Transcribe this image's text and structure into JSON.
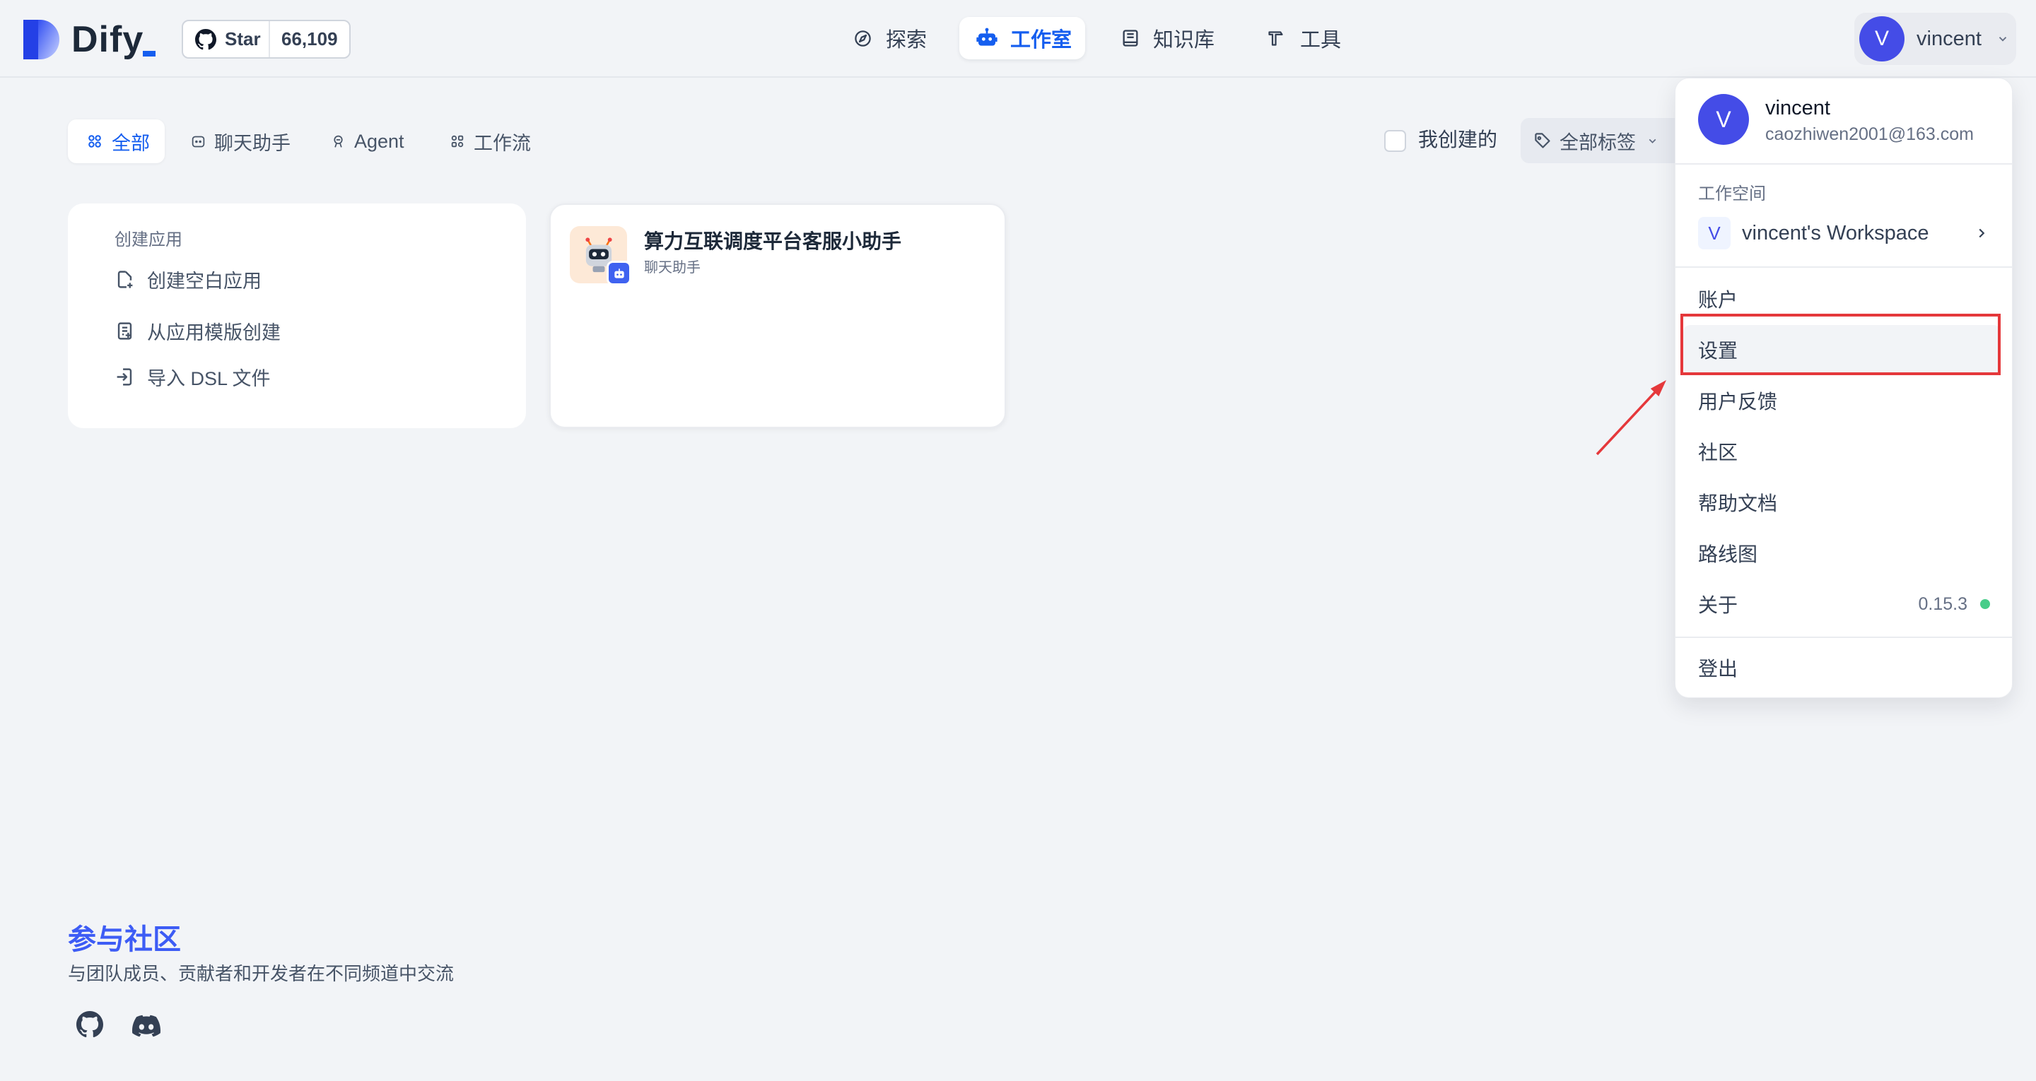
{
  "app": {
    "logo_text": "Dify"
  },
  "github": {
    "star_label": "Star",
    "star_count": "66,109",
    "icon": "github-icon"
  },
  "nav": {
    "items": [
      {
        "label": "探索",
        "icon": "explore-icon"
      },
      {
        "label": "工作室",
        "icon": "robot-icon",
        "active": true
      },
      {
        "label": "知识库",
        "icon": "book-icon"
      },
      {
        "label": "工具",
        "icon": "hammer-icon"
      }
    ]
  },
  "user": {
    "initial": "V",
    "name": "vincent"
  },
  "filters": {
    "tabs": [
      {
        "label": "全部",
        "icon": "grid-icon",
        "active": true
      },
      {
        "label": "聊天助手",
        "icon": "chat-icon"
      },
      {
        "label": "Agent",
        "icon": "agent-icon"
      },
      {
        "label": "工作流",
        "icon": "workflow-icon"
      }
    ],
    "created_by_me": {
      "label": "我创建的",
      "checked": false
    },
    "tags": {
      "label": "全部标签",
      "icon": "tag-icon"
    }
  },
  "create_card": {
    "title": "创建应用",
    "items": [
      {
        "label": "创建空白应用",
        "icon": "file-plus-icon"
      },
      {
        "label": "从应用模版创建",
        "icon": "template-icon"
      },
      {
        "label": "导入 DSL 文件",
        "icon": "import-icon"
      }
    ]
  },
  "apps": [
    {
      "name": "算力互联调度平台客服小助手",
      "type": "聊天助手",
      "icon": "robot-emoji-icon",
      "badge_icon": "robot-icon"
    }
  ],
  "community": {
    "title": "参与社区",
    "subtitle": "与团队成员、贡献者和开发者在不同频道中交流",
    "links": [
      {
        "icon": "github-icon"
      },
      {
        "icon": "discord-icon"
      }
    ]
  },
  "account_menu": {
    "initial": "V",
    "name": "vincent",
    "email": "caozhiwen2001@163.com",
    "workspace_label": "工作空间",
    "workspace": {
      "initial": "V",
      "name": "vincent's Workspace"
    },
    "items": [
      {
        "label": "账户"
      },
      {
        "label": "设置",
        "highlighted": true
      },
      {
        "label": "用户反馈"
      },
      {
        "label": "社区"
      },
      {
        "label": "帮助文档"
      },
      {
        "label": "路线图"
      },
      {
        "label": "关于"
      }
    ],
    "version": "0.15.3",
    "logout": "登出"
  },
  "colors": {
    "accent": "#155eef",
    "avatar": "#444ce7",
    "background": "#f2f4f7",
    "status_ok": "#47cd89",
    "annotation": "#e5383b"
  }
}
